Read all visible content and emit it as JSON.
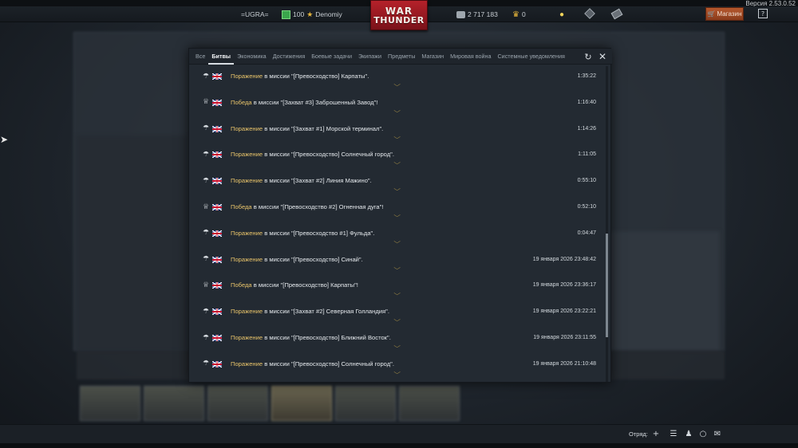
{
  "version": "Версия 2.53.0.52",
  "topbar": {
    "clan_tag": "=UGRA=",
    "level": "100",
    "player_name": "Denomiy",
    "logo_line1": "WAR",
    "logo_line2": "THUNDER",
    "silver_lions": "2 717 183",
    "golden_eagles": "0",
    "shop_label": "Магазин",
    "help_label": "?"
  },
  "dialog": {
    "tabs": [
      {
        "label": "Все"
      },
      {
        "label": "Битвы"
      },
      {
        "label": "Экономика"
      },
      {
        "label": "Достижения"
      },
      {
        "label": "Боевые задачи"
      },
      {
        "label": "Экипажи"
      },
      {
        "label": "Предметы"
      },
      {
        "label": "Магазин"
      },
      {
        "label": "Мировая война"
      },
      {
        "label": "Системные уведомления"
      }
    ],
    "active_tab": "Битвы",
    "battles": [
      {
        "result": "Поражение",
        "text": " в миссии \"[Превосходство] Карпаты\".",
        "time": "1:35:22",
        "icon": "parachute-icon"
      },
      {
        "result": "Победа",
        "text": " в миссии \"[Захват #3] Заброшенный Завод\"!",
        "time": "1:16:40",
        "icon": "trophy-icon"
      },
      {
        "result": "Поражение",
        "text": " в миссии \"[Захват #1] Морской терминал\".",
        "time": "1:14:26",
        "icon": "parachute-icon"
      },
      {
        "result": "Поражение",
        "text": " в миссии \"[Превосходство] Солнечный город\".",
        "time": "1:11:05",
        "icon": "parachute-icon"
      },
      {
        "result": "Поражение",
        "text": " в миссии \"[Захват #2] Линия Мажино\".",
        "time": "0:55:10",
        "icon": "parachute-icon"
      },
      {
        "result": "Победа",
        "text": " в миссии \"[Превосходство #2] Огненная дуга\"!",
        "time": "0:52:10",
        "icon": "trophy-icon"
      },
      {
        "result": "Поражение",
        "text": " в миссии \"[Превосходство #1] Фульда\".",
        "time": "0:04:47",
        "icon": "parachute-icon"
      },
      {
        "result": "Поражение",
        "text": " в миссии \"[Превосходство] Синай\".",
        "time": "19 января 2026 23:48:42",
        "icon": "parachute-icon"
      },
      {
        "result": "Победа",
        "text": " в миссии \"[Превосходство] Карпаты\"!",
        "time": "19 января 2026 23:36:17",
        "icon": "trophy-icon"
      },
      {
        "result": "Поражение",
        "text": " в миссии \"[Захват #2] Северная Голландия\".",
        "time": "19 января 2026 23:22:21",
        "icon": "parachute-icon"
      },
      {
        "result": "Поражение",
        "text": " в миссии \"[Превосходство] Ближний Восток\".",
        "time": "19 января 2026 23:11:55",
        "icon": "parachute-icon"
      },
      {
        "result": "Поражение",
        "text": " в миссии \"[Превосходство] Солнечный город\".",
        "time": "19 января 2026 21:10:48",
        "icon": "parachute-icon"
      }
    ]
  },
  "bottombar": {
    "squad_label": "Отряд:"
  },
  "colors": {
    "result_text": "#e9c46a",
    "shop_accent": "#b5582d",
    "logo_red": "#b5212a"
  }
}
